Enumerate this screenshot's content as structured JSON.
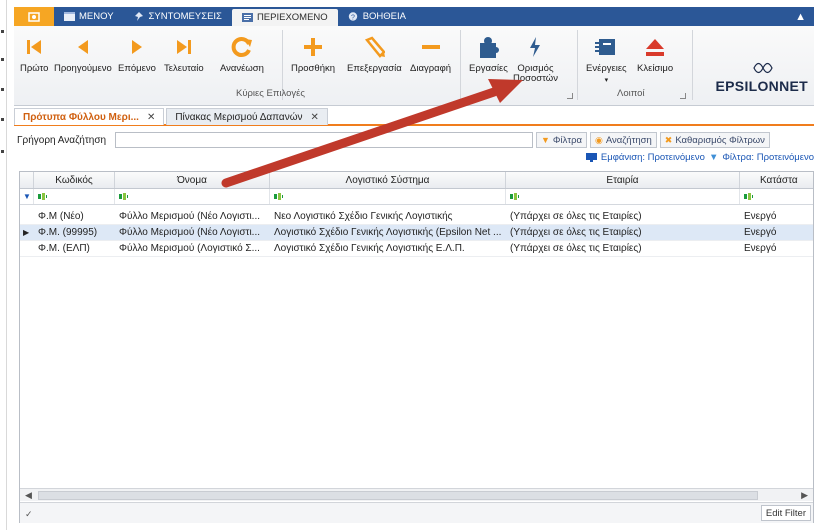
{
  "ribbon_tabs": [
    {
      "label": "ΜΕΝΟΥ",
      "icon": "menu-icon"
    },
    {
      "label": "ΣΥΝΤΟΜΕΥΣΕΙΣ",
      "icon": "pin-icon"
    },
    {
      "label": "ΠΕΡΙΕΧΟΜΕΝΟ",
      "icon": "content-icon"
    },
    {
      "label": "ΒΟΗΘΕΙΑ",
      "icon": "help-icon"
    }
  ],
  "ribbon": {
    "first": "Πρώτο",
    "previous": "Προηγούμενο",
    "next": "Επόμενο",
    "last": "Τελευταίο",
    "refresh": "Ανανέωση",
    "add": "Προσθήκη",
    "edit": "Επεξεργασία",
    "delete": "Διαγραφή",
    "tasks": "Εργασίες",
    "set_percentages_1": "Ορισμός",
    "set_percentages_2": "Ποσοστών",
    "actions": "Ενέργειες",
    "close": "Κλείσιμο",
    "group_main": "Κύριες Επιλογές",
    "group_other": "Λοιποί"
  },
  "logo": {
    "name_a": "EPSILON",
    "name_b": "NET"
  },
  "doc_tabs": [
    {
      "label": "Πρότυπα Φύλλου Μερι..."
    },
    {
      "label": "Πίνακας Μερισμού Δαπανών"
    }
  ],
  "search": {
    "label": "Γρήγορη Αναζήτηση",
    "value": "",
    "filters_btn": "Φίλτρα",
    "search_btn": "Αναζήτηση",
    "clear_btn": "Καθαρισμός Φίλτρων"
  },
  "view_line": {
    "view": "Εμφάνιση: Προτεινόμενο",
    "filters": "Φίλτρα: Προτεινόμενο"
  },
  "grid": {
    "columns": [
      "Κωδικός",
      "Όνομα",
      "Λογιστικό Σύστημα",
      "Εταιρία",
      "Κατάστα"
    ],
    "rows": [
      [
        "Φ.Μ (Νέο)",
        "Φύλλο Μερισμού (Νέο Λογιστι...",
        "Νεο Λογιστικό Σχέδιο Γενικής Λογιστικής",
        "(Υπάρχει σε όλες τις Εταιρίες)",
        "Ενεργό"
      ],
      [
        "Φ.Μ. (99995)",
        "Φύλλο Μερισμού (Νέο Λογιστι...",
        "Λογιστικό Σχέδιο Γενικής Λογιστικής (Epsilon Net ...",
        "(Υπάρχει σε όλες τις Εταιρίες)",
        "Ενεργό"
      ],
      [
        "Φ.Μ. (ΕΛΠ)",
        "Φύλλο Μερισμού (Λογιστικό Σ...",
        "Λογιστικό Σχέδιο Γενικής Λογιστικής Ε.Λ.Π.",
        "(Υπάρχει σε όλες τις Εταιρίες)",
        "Ενεργό"
      ]
    ],
    "edit_filter": "Edit Filter"
  },
  "colors": {
    "ribbon_tab_bar": "#2b5797",
    "app_button": "#f6a623",
    "active_doc_tab": "#d06010",
    "annotation_arrow": "#c0392b",
    "link_blue": "#1a56b5"
  }
}
